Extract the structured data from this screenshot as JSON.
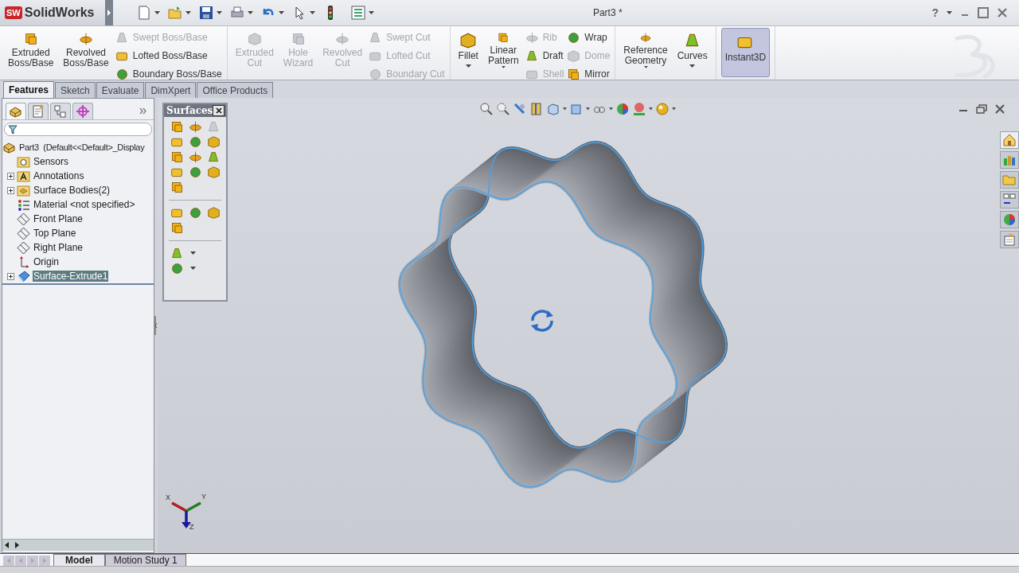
{
  "app": {
    "logo_badge": "SW",
    "logo_text": "SolidWorks"
  },
  "window": {
    "title": "Part3 *",
    "help": "?"
  },
  "ribbon": {
    "groups": [
      {
        "items": [
          {
            "kind": "large",
            "label": "Extruded Boss/Base",
            "disabled": false,
            "dropdown": false,
            "on": false
          },
          {
            "kind": "large",
            "label": "Revolved Boss/Base",
            "disabled": false,
            "dropdown": false,
            "on": false
          },
          {
            "kind": "stack",
            "items": [
              {
                "label": "Swept Boss/Base",
                "disabled": true
              },
              {
                "label": "Lofted Boss/Base",
                "disabled": false
              },
              {
                "label": "Boundary Boss/Base",
                "disabled": false
              }
            ]
          }
        ]
      },
      {
        "items": [
          {
            "kind": "large",
            "label": "Extruded Cut",
            "disabled": true,
            "dropdown": false,
            "on": false
          },
          {
            "kind": "large",
            "label": "Hole Wizard",
            "disabled": true,
            "dropdown": false,
            "on": false
          },
          {
            "kind": "large",
            "label": "Revolved Cut",
            "disabled": true,
            "dropdown": false,
            "on": false
          },
          {
            "kind": "stack",
            "items": [
              {
                "label": "Swept Cut",
                "disabled": true
              },
              {
                "label": "Lofted Cut",
                "disabled": true
              },
              {
                "label": "Boundary Cut",
                "disabled": true
              }
            ]
          }
        ]
      },
      {
        "items": [
          {
            "kind": "large",
            "label": "Fillet",
            "disabled": false,
            "dropdown": true,
            "on": false
          },
          {
            "kind": "large",
            "label": "Linear Pattern",
            "disabled": false,
            "dropdown": true,
            "on": false
          },
          {
            "kind": "stack",
            "items": [
              {
                "label": "Rib",
                "disabled": true
              },
              {
                "label": "Draft",
                "disabled": false
              },
              {
                "label": "Shell",
                "disabled": true
              }
            ]
          },
          {
            "kind": "stack",
            "items": [
              {
                "label": "Wrap",
                "disabled": false
              },
              {
                "label": "Dome",
                "disabled": true
              },
              {
                "label": "Mirror",
                "disabled": false
              }
            ]
          }
        ]
      },
      {
        "items": [
          {
            "kind": "large",
            "label": "Reference Geometry",
            "disabled": false,
            "dropdown": true,
            "on": false
          },
          {
            "kind": "large",
            "label": "Curves",
            "disabled": false,
            "dropdown": true,
            "on": false
          }
        ]
      },
      {
        "items": [
          {
            "kind": "large",
            "label": "Instant3D",
            "disabled": false,
            "dropdown": false,
            "on": true
          }
        ]
      }
    ]
  },
  "tabs": [
    {
      "label": "Features",
      "selected": true
    },
    {
      "label": "Sketch",
      "selected": false
    },
    {
      "label": "Evaluate",
      "selected": false
    },
    {
      "label": "DimXpert",
      "selected": false
    },
    {
      "label": "Office Products",
      "selected": false
    }
  ],
  "feature_manager": {
    "panel_tabs": [
      {
        "selected": true
      },
      {
        "selected": false
      },
      {
        "selected": false
      },
      {
        "selected": false
      }
    ],
    "tree": {
      "label": "Part3  (Default<<Default>_Display",
      "kind": "part",
      "children": [
        {
          "label": "Sensors",
          "kind": "sensor",
          "expandable": false,
          "selected": false
        },
        {
          "label": "Annotations",
          "kind": "annotation",
          "expandable": true,
          "selected": false
        },
        {
          "label": "Surface Bodies(2)",
          "kind": "bodies",
          "expandable": true,
          "selected": false
        },
        {
          "label": "Material <not specified>",
          "kind": "material",
          "expandable": false,
          "selected": false
        },
        {
          "label": "Front Plane",
          "kind": "plane",
          "expandable": false,
          "selected": false
        },
        {
          "label": "Top Plane",
          "kind": "plane",
          "expandable": false,
          "selected": false
        },
        {
          "label": "Right Plane",
          "kind": "plane",
          "expandable": false,
          "selected": false
        },
        {
          "label": "Origin",
          "kind": "origin",
          "expandable": false,
          "selected": false
        },
        {
          "label": "Surface-Extrude1",
          "kind": "feature",
          "expandable": true,
          "selected": true
        }
      ]
    }
  },
  "surfaces_toolbar": {
    "title": "Surfaces"
  },
  "task_pane": [
    {
      "selected": true
    },
    {
      "selected": false
    },
    {
      "selected": false
    },
    {
      "selected": false
    },
    {
      "selected": false
    },
    {
      "selected": false
    }
  ],
  "triad": {
    "x": "X",
    "y": "Y",
    "z": "Z"
  },
  "bottom_tabs": [
    {
      "label": "Model",
      "selected": true
    },
    {
      "label": "Motion Study 1",
      "selected": false
    }
  ]
}
